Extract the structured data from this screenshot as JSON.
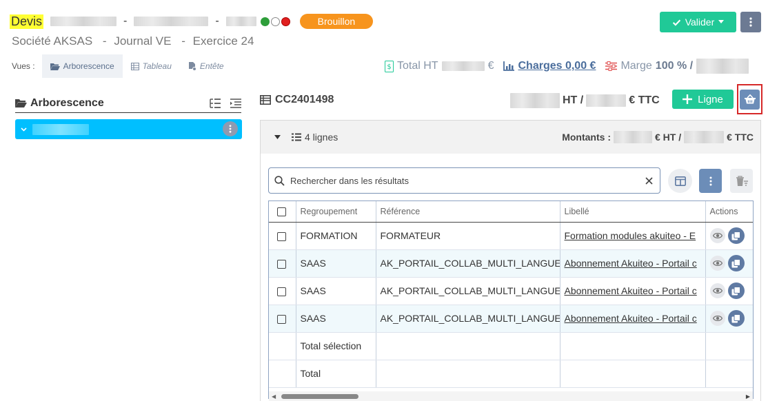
{
  "header": {
    "doc_type": "Devis",
    "dash": "-",
    "status": "Brouillon",
    "company": "Société AKSAS",
    "journal": "Journal VE",
    "exercise": "Exercice 24",
    "sep": "-",
    "status_dot_colors": [
      "#2e9e3a",
      "#ffffff",
      "#e02020"
    ]
  },
  "actions": {
    "validate_label": "Valider"
  },
  "views": {
    "label": "Vues :",
    "tabs": [
      "Arborescence",
      "Tableau",
      "Entête"
    ]
  },
  "totals": {
    "total_ht_label": "Total HT",
    "currency": "€",
    "charges": "Charges 0,00 €",
    "marge_label": "Marge",
    "marge_value": "100 % /"
  },
  "left_panel": {
    "title": "Arborescence"
  },
  "document": {
    "code": "CC2401498",
    "ht_suffix": "HT /",
    "ttc_suffix": "€ TTC",
    "add_line_label": "Ligne"
  },
  "lines": {
    "count_label": "4 lignes",
    "montants_label": "Montants :",
    "ht_suffix": "€ HT /",
    "ttc_suffix": "€ TTC",
    "search_placeholder": "Rechercher dans les résultats",
    "columns": [
      "Regroupement",
      "Référence",
      "Libellé",
      "Actions"
    ],
    "rows": [
      {
        "regroupement": "FORMATION",
        "reference": "FORMATEUR",
        "libelle": "Formation modules akuiteo - E"
      },
      {
        "regroupement": "SAAS",
        "reference": "AK_PORTAIL_COLLAB_MULTI_LANGUE",
        "libelle": "Abonnement Akuiteo - Portail c"
      },
      {
        "regroupement": "SAAS",
        "reference": "AK_PORTAIL_COLLAB_MULTI_LANGUE",
        "libelle": "Abonnement Akuiteo - Portail c"
      },
      {
        "regroupement": "SAAS",
        "reference": "AK_PORTAIL_COLLAB_MULTI_LANGUE",
        "libelle": "Abonnement Akuiteo - Portail c"
      }
    ],
    "total_selection_label": "Total sélection",
    "total_label": "Total"
  },
  "colors": {
    "accent_green": "#20c997",
    "status_orange": "#f7941d",
    "tree_selected": "#00bfff",
    "highlight_red": "#d62828"
  }
}
